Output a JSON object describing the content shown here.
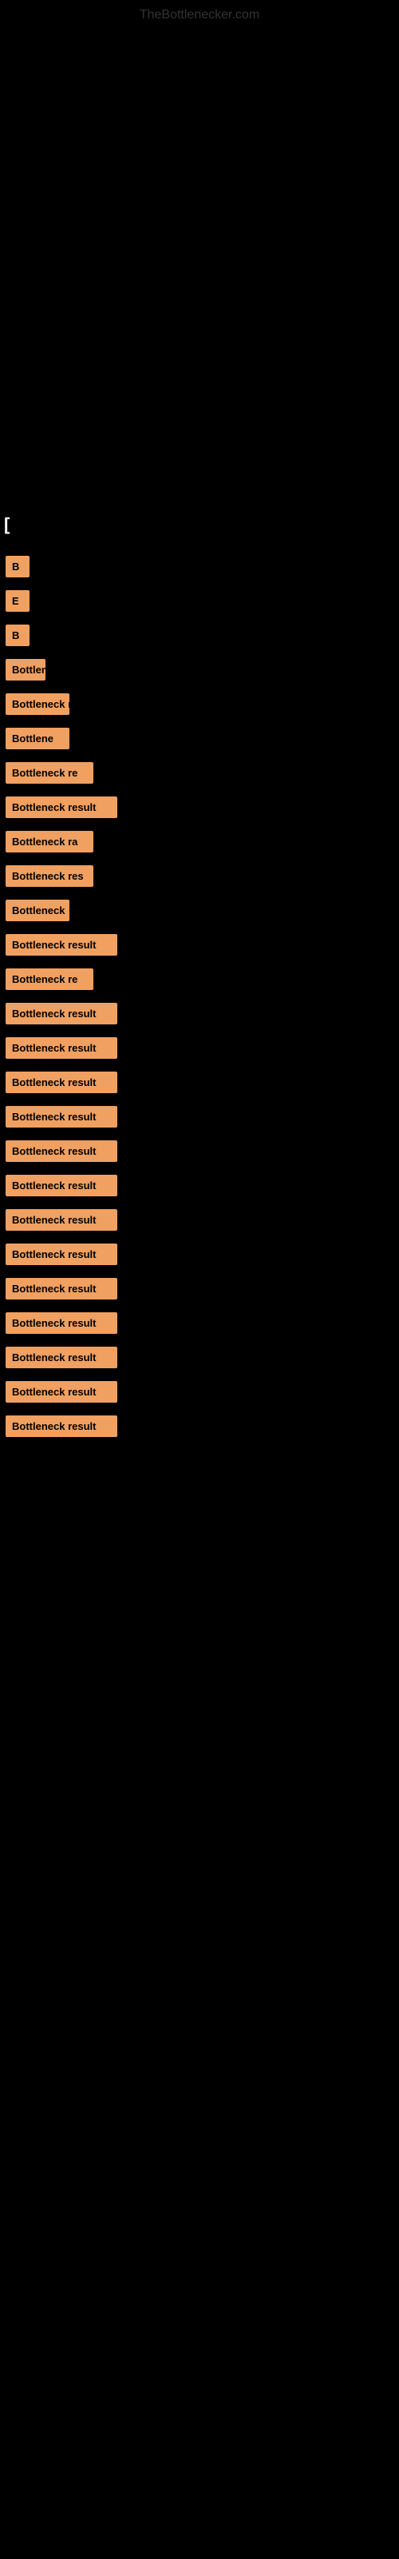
{
  "site": {
    "title": "TheBottlenecker.com"
  },
  "page": {
    "section_label": "[",
    "rows": [
      {
        "id": 1,
        "label": "B",
        "width_class": "w-tiny",
        "text": "B"
      },
      {
        "id": 2,
        "label": "E",
        "width_class": "w-tiny",
        "text": "E"
      },
      {
        "id": 3,
        "label": "B",
        "width_class": "w-tiny",
        "text": "B"
      },
      {
        "id": 4,
        "label": "Bottlen",
        "width_class": "w-small",
        "text": "Bottlen"
      },
      {
        "id": 5,
        "label": "Bottleneck r",
        "width_class": "w-medium",
        "text": "Bottleneck r"
      },
      {
        "id": 6,
        "label": "Bottlene",
        "width_class": "w-medium",
        "text": "Bottlene"
      },
      {
        "id": 7,
        "label": "Bottleneck re",
        "width_class": "w-large",
        "text": "Bottleneck re"
      },
      {
        "id": 8,
        "label": "Bottleneck result",
        "width_class": "w-full",
        "text": "Bottleneck result"
      },
      {
        "id": 9,
        "label": "Bottleneck ra",
        "width_class": "w-large",
        "text": "Bottleneck ra"
      },
      {
        "id": 10,
        "label": "Bottleneck res",
        "width_class": "w-large",
        "text": "Bottleneck res"
      },
      {
        "id": 11,
        "label": "Bottleneck",
        "width_class": "w-medium",
        "text": "Bottleneck"
      },
      {
        "id": 12,
        "label": "Bottleneck result",
        "width_class": "w-full",
        "text": "Bottleneck result"
      },
      {
        "id": 13,
        "label": "Bottleneck re",
        "width_class": "w-large",
        "text": "Bottleneck re"
      },
      {
        "id": 14,
        "label": "Bottleneck result",
        "width_class": "w-full",
        "text": "Bottleneck result"
      },
      {
        "id": 15,
        "label": "Bottleneck result",
        "width_class": "w-full",
        "text": "Bottleneck result"
      },
      {
        "id": 16,
        "label": "Bottleneck result",
        "width_class": "w-full",
        "text": "Bottleneck result"
      },
      {
        "id": 17,
        "label": "Bottleneck result",
        "width_class": "w-full",
        "text": "Bottleneck result"
      },
      {
        "id": 18,
        "label": "Bottleneck result",
        "width_class": "w-full",
        "text": "Bottleneck result"
      },
      {
        "id": 19,
        "label": "Bottleneck result",
        "width_class": "w-full",
        "text": "Bottleneck result"
      },
      {
        "id": 20,
        "label": "Bottleneck result",
        "width_class": "w-full",
        "text": "Bottleneck result"
      },
      {
        "id": 21,
        "label": "Bottleneck result",
        "width_class": "w-full",
        "text": "Bottleneck result"
      },
      {
        "id": 22,
        "label": "Bottleneck result",
        "width_class": "w-full",
        "text": "Bottleneck result"
      },
      {
        "id": 23,
        "label": "Bottleneck result",
        "width_class": "w-full",
        "text": "Bottleneck result"
      },
      {
        "id": 24,
        "label": "Bottleneck result",
        "width_class": "w-full",
        "text": "Bottleneck result"
      },
      {
        "id": 25,
        "label": "Bottleneck result",
        "width_class": "w-full",
        "text": "Bottleneck result"
      },
      {
        "id": 26,
        "label": "Bottleneck result",
        "width_class": "w-full",
        "text": "Bottleneck result"
      }
    ]
  }
}
